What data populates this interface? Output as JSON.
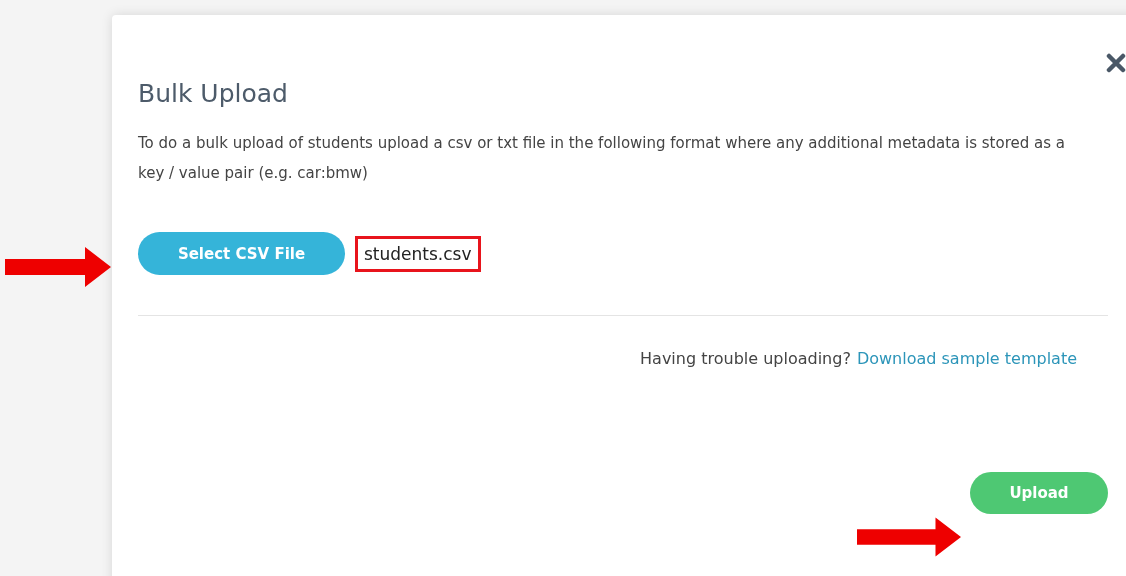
{
  "dialog": {
    "title": "Bulk Upload",
    "description": "To do a bulk upload of students upload a csv or txt file in the following format where any additional metadata is stored as a key / value pair (e.g. car:bmw)",
    "select_button": "Select CSV File",
    "file_name": {
      "text": "students.csv",
      "highlighted": true
    },
    "help_text": "Having trouble uploading?",
    "help_link": "Download sample template",
    "upload_button": "Upload"
  }
}
